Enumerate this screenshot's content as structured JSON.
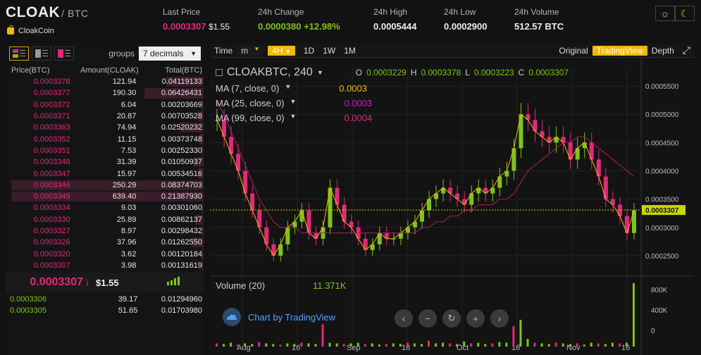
{
  "header": {
    "symbol": "CLOAK",
    "quote": "/ BTC",
    "coin_name": "CloakCoin",
    "last_price_label": "Last Price",
    "last_price": "0.0003307",
    "last_price_usd": "$1.55",
    "change_label": "24h Change",
    "change_value": "0.0000380",
    "change_pct": "+12.98%",
    "high_label": "24h High",
    "high_value": "0.0005444",
    "low_label": "24h Low",
    "low_value": "0.0002900",
    "volume_label": "24h Volume",
    "volume_value": "512.57 BTC",
    "sun_icon": "☼",
    "moon_icon": "☾"
  },
  "orderbook": {
    "groups_label": "groups",
    "groups_value": "7 decimals",
    "col_price": "Price(BTC)",
    "col_amount": "Amount(CLOAK)",
    "col_total": "Total(BTC)",
    "asks": [
      {
        "price": "0.0003378",
        "amount": "121.94",
        "total": "0.04119133",
        "depth": 0.19
      },
      {
        "price": "0.0003377",
        "amount": "190.30",
        "total": "0.06426431",
        "depth": 0.3
      },
      {
        "price": "0.0003372",
        "amount": "6.04",
        "total": "0.00203669",
        "depth": 0.01
      },
      {
        "price": "0.0003371",
        "amount": "20.87",
        "total": "0.00703528",
        "depth": 0.03
      },
      {
        "price": "0.0003363",
        "amount": "74.94",
        "total": "0.02520232",
        "depth": 0.12
      },
      {
        "price": "0.0003352",
        "amount": "11.15",
        "total": "0.00373748",
        "depth": 0.02
      },
      {
        "price": "0.0003351",
        "amount": "7.53",
        "total": "0.00252330",
        "depth": 0.01
      },
      {
        "price": "0.0003348",
        "amount": "31.39",
        "total": "0.01050937",
        "depth": 0.05
      },
      {
        "price": "0.0003347",
        "amount": "15.97",
        "total": "0.00534516",
        "depth": 0.03
      },
      {
        "price": "0.0003346",
        "amount": "250.29",
        "total": "0.08374703",
        "depth": 0.97
      },
      {
        "price": "0.0003345",
        "amount": "639.40",
        "total": "0.21387930",
        "depth": 0.97
      },
      {
        "price": "0.0003334",
        "amount": "9.03",
        "total": "0.00301060",
        "depth": 0.01
      },
      {
        "price": "0.0003330",
        "amount": "25.89",
        "total": "0.00862137",
        "depth": 0.04
      },
      {
        "price": "0.0003327",
        "amount": "8.97",
        "total": "0.00298432",
        "depth": 0.01
      },
      {
        "price": "0.0003326",
        "amount": "37.96",
        "total": "0.01262550",
        "depth": 0.06
      },
      {
        "price": "0.0003320",
        "amount": "3.62",
        "total": "0.00120184",
        "depth": 0.01
      },
      {
        "price": "0.0003307",
        "amount": "3.98",
        "total": "0.00131619",
        "depth": 0.01
      }
    ],
    "mid_price": "0.0003307",
    "mid_arrow": "↓",
    "mid_usd": "$1.55",
    "bids": [
      {
        "price": "0.0003306",
        "amount": "39.17",
        "total": "0.01294960"
      },
      {
        "price": "0.0003305",
        "amount": "51.65",
        "total": "0.01703980"
      }
    ]
  },
  "chart_toolbar": {
    "time_label": "Time",
    "minute_label": "m",
    "interval_4h": "4H",
    "interval_1d": "1D",
    "interval_1w": "1W",
    "interval_1m": "1M",
    "original_label": "Original",
    "tradingview_label": "TradingView",
    "depth_label": "Depth"
  },
  "chart_legend": {
    "symbol": "CLOAKBTC, 240",
    "open_label": "O",
    "open": "0.0003229",
    "high_label": "H",
    "high": "0.0003378",
    "low_label": "L",
    "low": "0.0003223",
    "close_label": "C",
    "close": "0.0003307",
    "ma7_label": "MA (7, close, 0)",
    "ma7_value": "0.0003",
    "ma25_label": "MA (25, close, 0)",
    "ma25_value": "0.0003",
    "ma99_label": "MA (99, close, 0)",
    "ma99_value": "0.0004",
    "volume_label": "Volume (20)",
    "volume_value": "11.371K",
    "tv_label": "Chart by TradingView",
    "price_tag": "0.0003307"
  },
  "chart_data": {
    "type": "line",
    "x_ticks": [
      "Aug",
      "16",
      "Sep",
      "16",
      "Oct",
      "16",
      "Nov",
      "16"
    ],
    "y_ticks": [
      "0.0005500",
      "0.0005000",
      "0.0004500",
      "0.0004000",
      "0.0003500",
      "0.0003000",
      "0.0002500"
    ],
    "ylim": [
      0.00022,
      0.00058
    ],
    "vol_ticks": [
      "800K",
      "400K",
      "0"
    ],
    "price_series": [
      0.00049,
      0.00046,
      0.00043,
      0.0004,
      0.00036,
      0.00033,
      0.0003,
      0.00027,
      0.00025,
      0.00027,
      0.0003,
      0.00031,
      0.00033,
      0.00029,
      0.00028,
      0.0003,
      0.00037,
      0.00034,
      0.00031,
      0.0003,
      0.00028,
      0.00026,
      0.00027,
      0.00029,
      0.00028,
      0.00028,
      0.00029,
      0.0003,
      0.00031,
      0.00033,
      0.00035,
      0.00036,
      0.00037,
      0.00036,
      0.00035,
      0.00034,
      0.00036,
      0.00037,
      0.00036,
      0.00037,
      0.00039,
      0.0004,
      0.00044,
      0.0005,
      0.00049,
      0.00047,
      0.00046,
      0.00045,
      0.00046,
      0.00045,
      0.00042,
      0.00044,
      0.00045,
      0.00042,
      0.00039,
      0.00035,
      0.00034,
      0.00032,
      0.00029,
      0.00033
    ],
    "ma99_series": [
      0.00052,
      0.0005,
      0.00047,
      0.00044,
      0.00041,
      0.00038,
      0.00035,
      0.00033,
      0.00031,
      0.0003,
      0.0003,
      0.0003,
      0.00029,
      0.00029,
      0.00029,
      0.00029,
      0.00029,
      0.00029,
      0.00029,
      0.00029,
      0.00029,
      0.00029,
      0.00029,
      0.00029,
      0.00029,
      0.00029,
      0.00029,
      0.00029,
      0.00029,
      0.0003,
      0.0003,
      0.00031,
      0.00031,
      0.00032,
      0.00032,
      0.00033,
      0.00033,
      0.00034,
      0.00034,
      0.00034,
      0.00035,
      0.00035,
      0.00036,
      0.00038,
      0.0004,
      0.00041,
      0.00042,
      0.00043,
      0.00044,
      0.00045,
      0.00045,
      0.00046,
      0.00046,
      0.00045,
      0.00044,
      0.00043,
      0.00042,
      0.00041,
      0.0004,
      0.00039
    ],
    "volume_series": [
      0.05,
      0.04,
      0.06,
      0.03,
      0.05,
      0.04,
      0.07,
      0.05,
      0.04,
      0.03,
      0.05,
      0.04,
      0.06,
      0.05,
      0.04,
      0.35,
      0.06,
      0.05,
      0.04,
      0.05,
      0.06,
      0.04,
      0.05,
      0.03,
      0.04,
      0.05,
      0.04,
      0.06,
      0.05,
      0.04,
      0.09,
      0.05,
      0.06,
      0.05,
      0.04,
      0.08,
      0.05,
      0.06,
      0.04,
      0.05,
      0.07,
      0.06,
      0.32,
      0.42,
      0.12,
      0.06,
      0.05,
      0.04,
      0.06,
      0.05,
      0.04,
      0.05,
      0.03,
      0.06,
      0.05,
      0.04,
      0.06,
      0.05,
      0.06,
      1.0
    ]
  }
}
